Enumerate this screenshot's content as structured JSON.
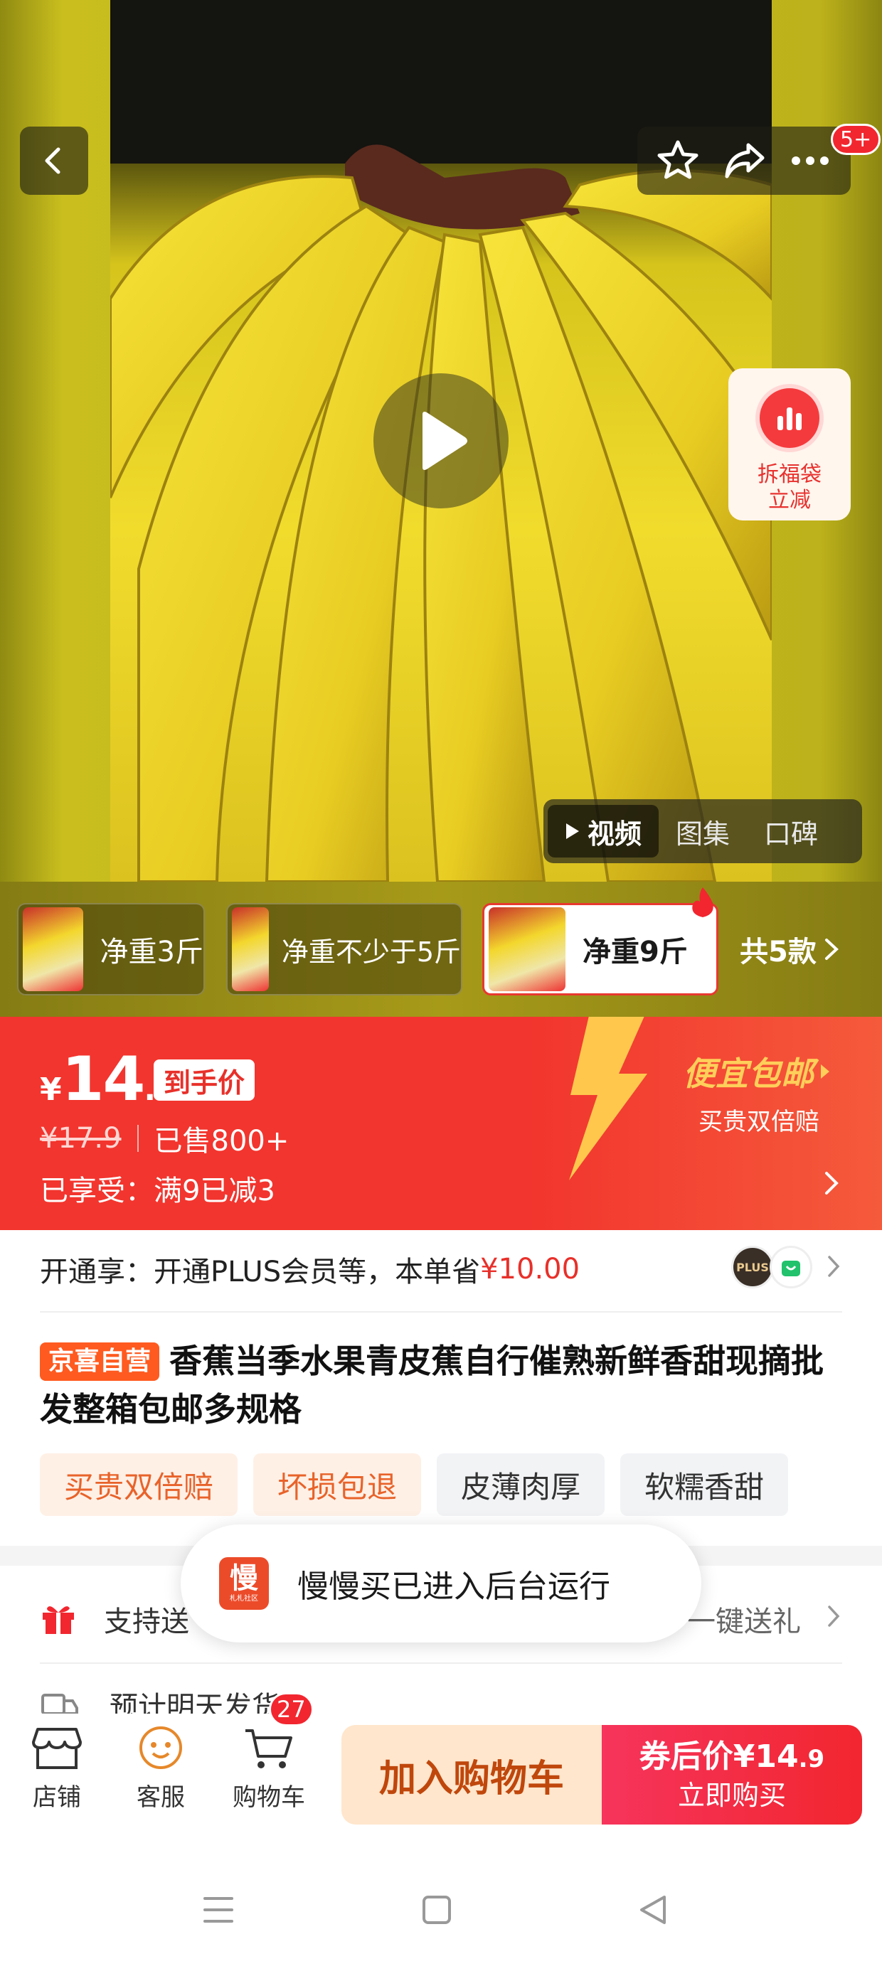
{
  "media": {
    "tabs": [
      {
        "label": "视频",
        "active": true
      },
      {
        "label": "图集",
        "active": false
      },
      {
        "label": "口碑",
        "active": false
      }
    ],
    "notification_count": "5+",
    "promo_float": {
      "line1": "拆福袋",
      "line2": "立减"
    }
  },
  "sku": {
    "options": [
      {
        "label": "净重3斤",
        "active": false
      },
      {
        "label": "净重不少于5斤",
        "active": false
      },
      {
        "label": "净重9斤",
        "active": true
      }
    ],
    "more_label": "共5款"
  },
  "price": {
    "currency": "¥",
    "integer": "14",
    "decimal": ".9",
    "final_tag": "到手价",
    "original": "¥17.9",
    "sold": "已售800+",
    "enjoyed": "已享受：满9已减3",
    "cheap_shipping": "便宜包邮",
    "double_compensation": "买贵双倍赔"
  },
  "plus": {
    "text": "开通享：开通PLUS会员等，本单省",
    "saving": "¥10.00",
    "icon1": "PLUS"
  },
  "product": {
    "badge": "京喜自营",
    "title": "香蕉当季水果青皮蕉自行催熟新鲜香甜现摘批发整箱包邮多规格",
    "tags": [
      {
        "label": "买贵双倍赔",
        "style": "warm"
      },
      {
        "label": "坏损包退",
        "style": "warm"
      },
      {
        "label": "皮薄肉厚",
        "style": "gray"
      },
      {
        "label": "软糯香甜",
        "style": "gray"
      }
    ]
  },
  "services": {
    "gift_label": "支持送",
    "gift_right": "一键送礼",
    "ship_label": "预计明天发货"
  },
  "toast": {
    "logo_big": "慢",
    "logo_small": "札札社区",
    "message": "慢慢买已进入后台运行"
  },
  "bottom_bar": {
    "store": "店铺",
    "service": "客服",
    "cart": "购物车",
    "cart_count": "27",
    "add_to_cart": "加入购物车",
    "buy_price_prefix": "券后价",
    "buy_price_currency": "¥",
    "buy_price_integer": "14",
    "buy_price_decimal": ".9",
    "buy_now": "立即购买"
  },
  "colors": {
    "accent_red": "#f2352e",
    "cheap_gold": "#ffcf5a",
    "jx_orange": "#ff5a1f"
  }
}
